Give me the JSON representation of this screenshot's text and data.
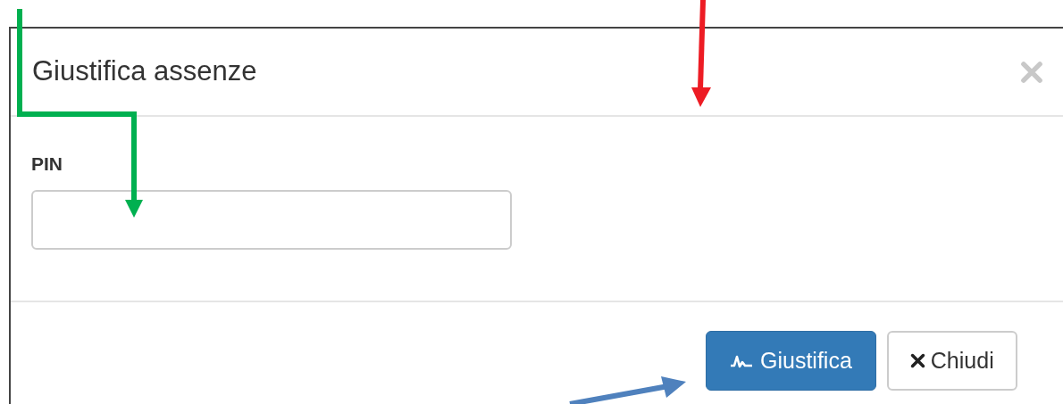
{
  "dialog": {
    "title": "Giustifica assenze"
  },
  "fields": [
    {
      "label": "PIN"
    }
  ],
  "buttons": [
    {
      "label": "Giustifica",
      "kind": "primary"
    },
    {
      "label": "Chiudi",
      "kind": "default"
    }
  ],
  "annotations": [
    {
      "kind": "elbow",
      "color": "#00b050"
    },
    {
      "kind": "down",
      "color": "#ed1c24"
    },
    {
      "kind": "diagonal",
      "color": "#4f81bd"
    }
  ]
}
